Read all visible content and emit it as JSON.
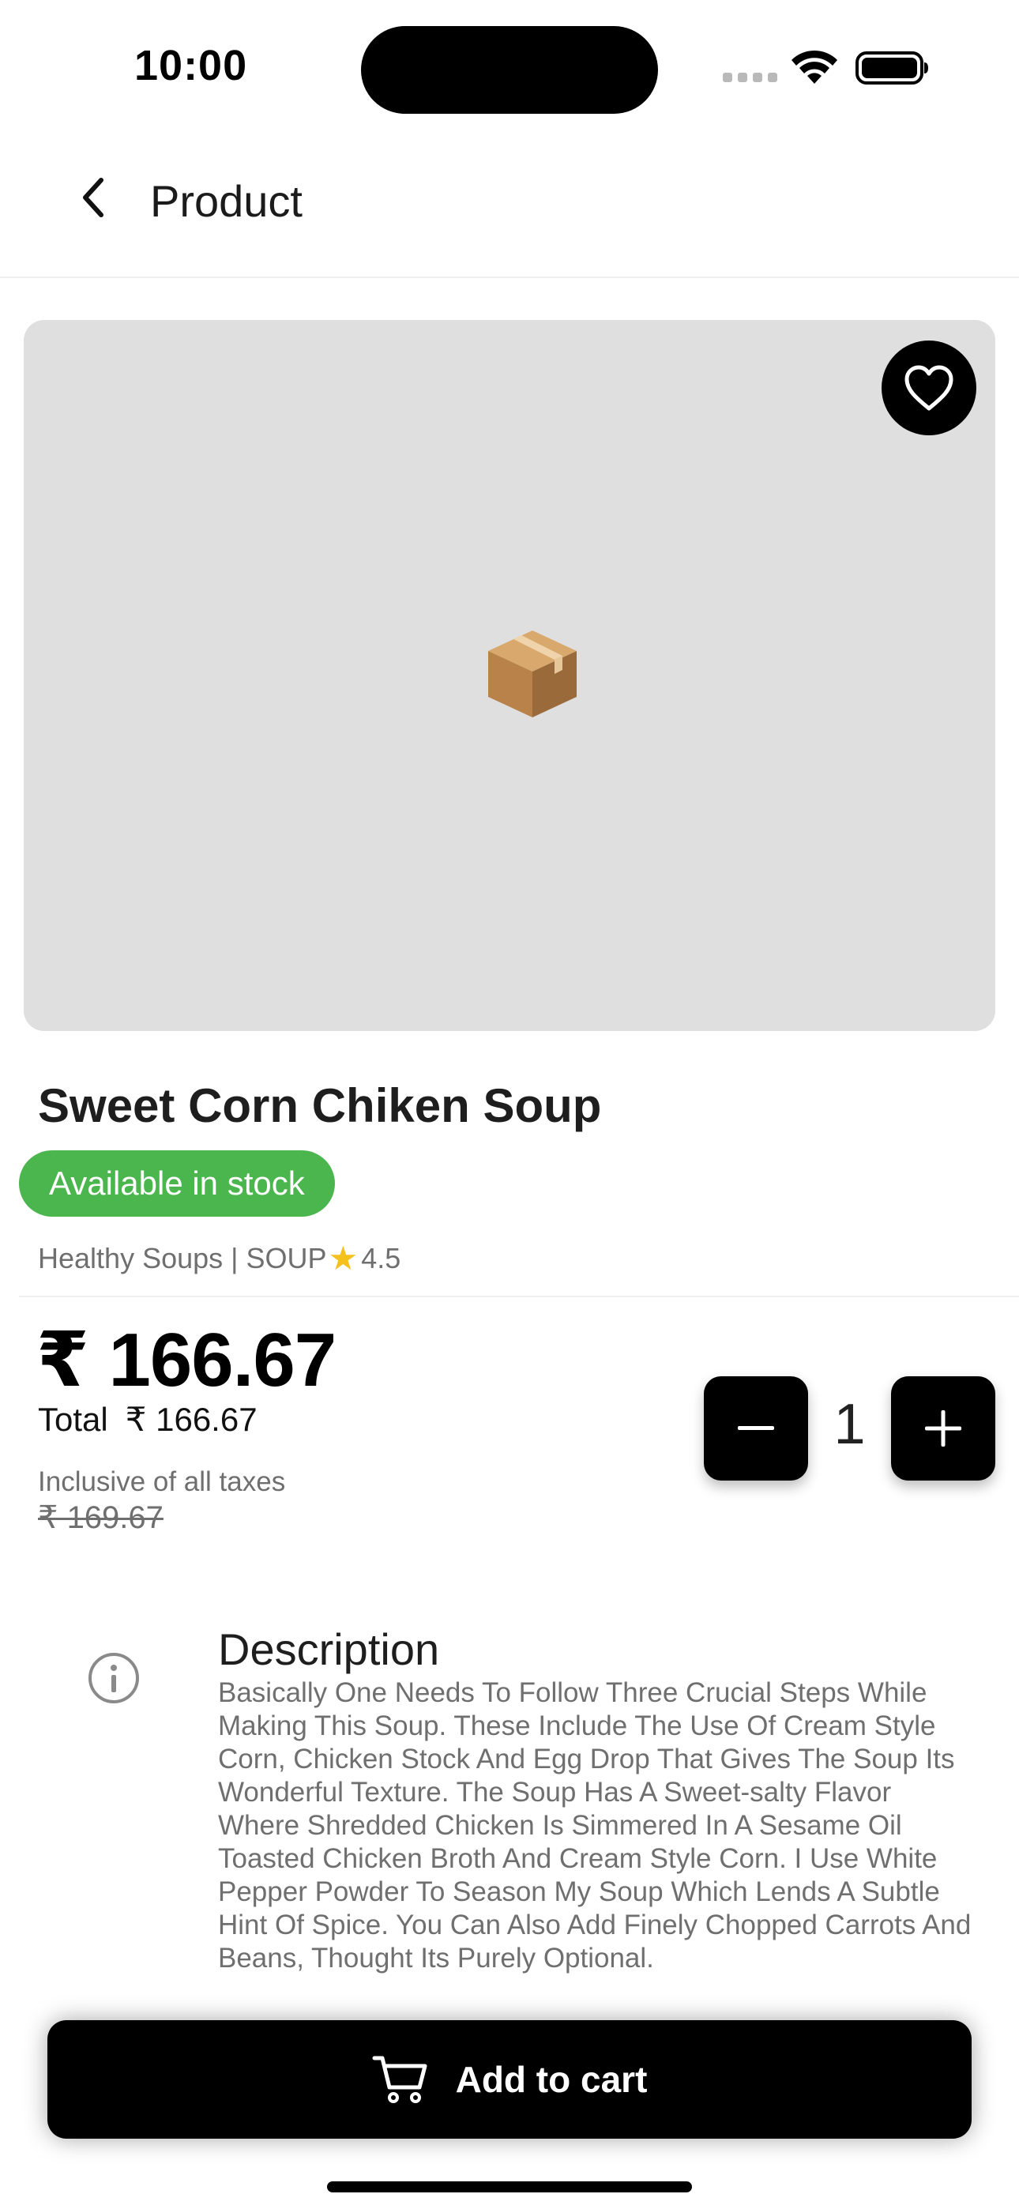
{
  "status_bar": {
    "time": "10:00"
  },
  "header": {
    "title": "Product",
    "back_icon": "chevron-left-icon"
  },
  "product": {
    "image_placeholder_icon": "package-box-icon",
    "favorite_icon": "heart-icon",
    "name": "Sweet Corn Chiken Soup",
    "stock_status": "Available in stock",
    "category": "Healthy Soups | SOUP",
    "rating_icon": "star-icon",
    "rating": "4.5",
    "price": "₹ 166.67",
    "total_label": "Total",
    "total_value": "₹ 166.67",
    "tax_note": "Inclusive of all taxes",
    "mrp": "₹ 169.67"
  },
  "quantity": {
    "value": "1",
    "decrement_icon": "minus-icon",
    "increment_icon": "plus-icon"
  },
  "description": {
    "icon": "info-icon",
    "title": "Description",
    "body": "Basically One Needs To Follow Three Crucial Steps While Making This Soup. These Include The Use Of Cream Style Corn, Chicken Stock And Egg Drop That Gives The Soup Its Wonderful Texture. The Soup Has A Sweet-salty Flavor Where Shredded Chicken Is Simmered In A Sesame Oil Toasted Chicken Broth And Cream Style Corn. I Use White Pepper Powder To Season My Soup Which Lends A Subtle Hint Of Spice. You Can Also Add Finely Chopped Carrots And Beans, Thought Its Purely Optional."
  },
  "cart": {
    "label": "Add to cart",
    "icon": "cart-icon"
  },
  "colors": {
    "stock_badge": "#4bb54e",
    "primary": "#000000",
    "image_bg": "#dfdfdf",
    "star": "#f5c21b",
    "muted_text": "#6f6f6f"
  }
}
